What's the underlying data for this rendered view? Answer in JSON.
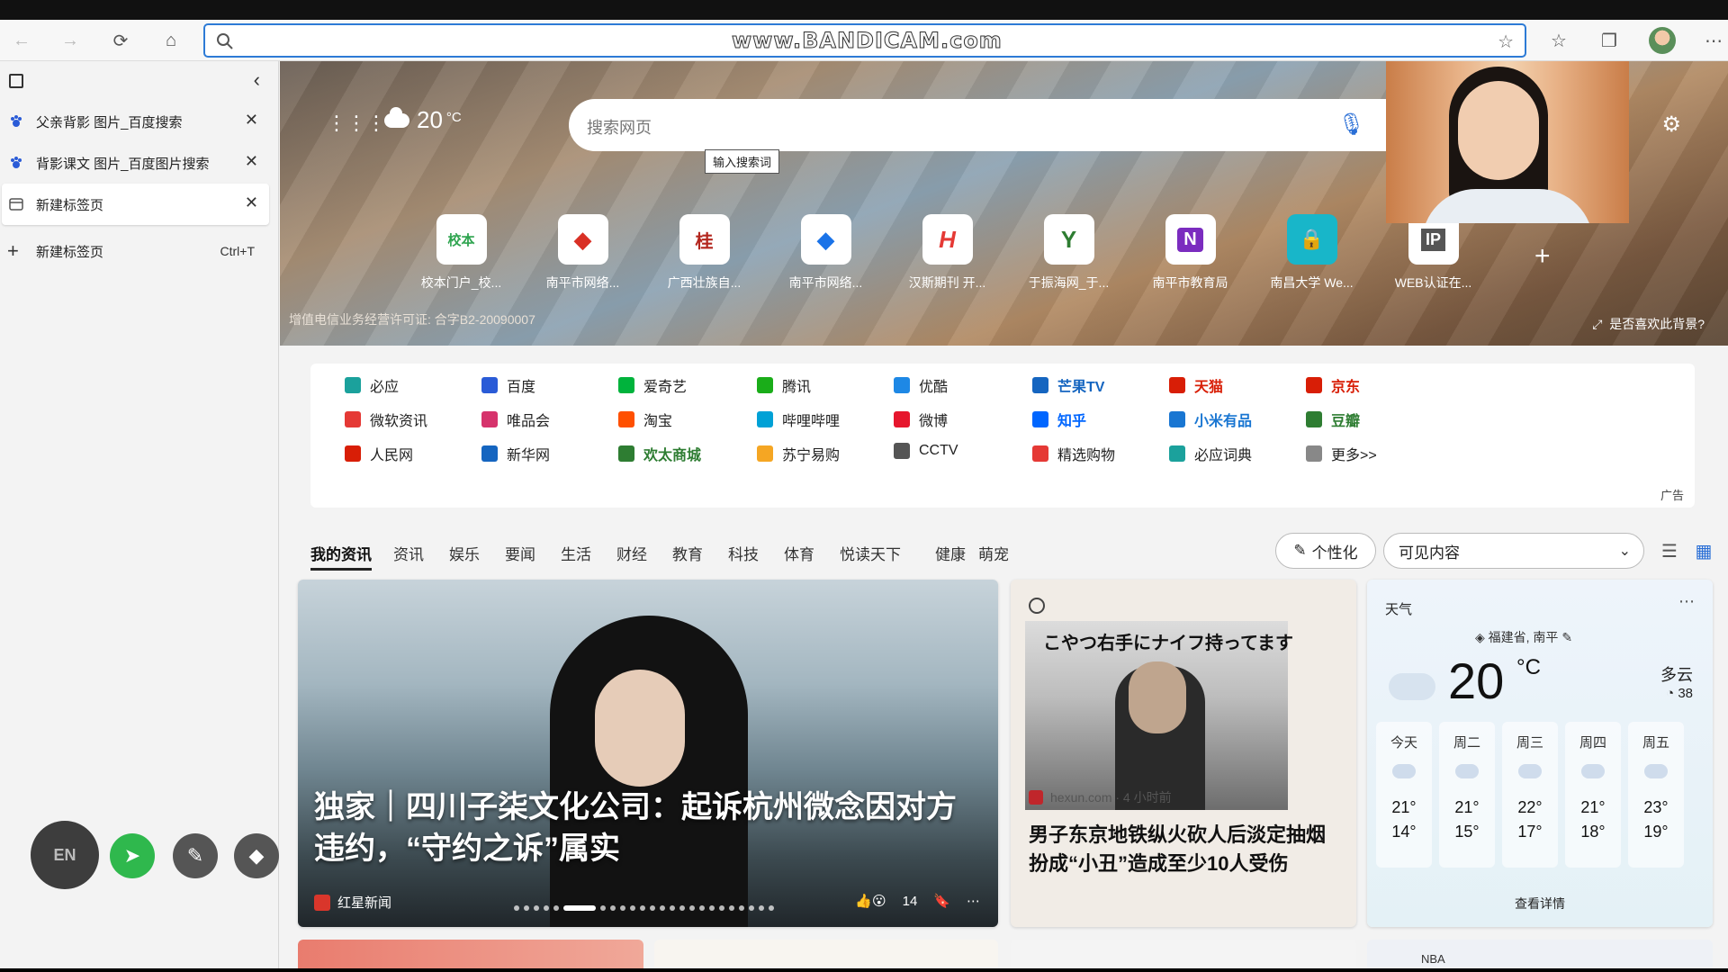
{
  "browser": {
    "watermark": "www.BANDICAM.com",
    "address_placeholder": ""
  },
  "sidebar": {
    "tabs": [
      {
        "label": "父亲背影 图片_百度搜索",
        "active": false
      },
      {
        "label": "背影课文 图片_百度图片搜索",
        "active": false
      },
      {
        "label": "新建标签页",
        "active": true
      }
    ],
    "new_tab": {
      "label": "新建标签页",
      "shortcut": "Ctrl+T"
    }
  },
  "annot_tools": {
    "lang": "EN"
  },
  "hero": {
    "temperature": "20",
    "temp_unit": "°C",
    "search_placeholder": "搜索网页",
    "tooltip": "输入搜索词",
    "quick_links": [
      {
        "label": "校本门户_校...",
        "glyph": "校本",
        "color": "#2ea44f"
      },
      {
        "label": "南平市网络...",
        "glyph": "◆",
        "color": "#d93025"
      },
      {
        "label": "广西壮族自...",
        "glyph": "桂",
        "color": "#b3261e"
      },
      {
        "label": "南平市网络...",
        "glyph": "◆",
        "color": "#1a73e8"
      },
      {
        "label": "汉斯期刊 开...",
        "glyph": "H",
        "color": "#e53935"
      },
      {
        "label": "于振海网_于...",
        "glyph": "Y",
        "color": "#2e7d32"
      },
      {
        "label": "南平市教育局",
        "glyph": "N",
        "color": "#7b2cbf"
      },
      {
        "label": "南昌大学 We...",
        "glyph": "🔒",
        "color": "#18b6c9"
      },
      {
        "label": "WEB认证在...",
        "glyph": "IP",
        "color": "#555555"
      }
    ],
    "license": "增值电信业务经营许可证: 合字B2-20090007",
    "like_background": "是否喜欢此背景?"
  },
  "links": [
    [
      {
        "label": "必应",
        "color": "#1ba19c",
        "bold": false
      },
      {
        "label": "百度",
        "color": "#2a5bd7",
        "bold": false
      },
      {
        "label": "爱奇艺",
        "color": "#00b33c",
        "bold": false
      },
      {
        "label": "腾讯",
        "color": "#1aad19",
        "bold": false
      },
      {
        "label": "优酷",
        "color": "#1e88e5",
        "bold": false
      },
      {
        "label": "芒果TV",
        "color": "#1565c0",
        "bold": true
      },
      {
        "label": "天猫",
        "color": "#d81e06",
        "bold": true
      },
      {
        "label": "京东",
        "color": "#d81e06",
        "bold": true
      }
    ],
    [
      {
        "label": "微软资讯",
        "color": "#e53935",
        "bold": false
      },
      {
        "label": "唯品会",
        "color": "#d6336c",
        "bold": false
      },
      {
        "label": "淘宝",
        "color": "#ff5000",
        "bold": false
      },
      {
        "label": "哔哩哔哩",
        "color": "#00a1d6",
        "bold": false
      },
      {
        "label": "微博",
        "color": "#e6162d",
        "bold": false
      },
      {
        "label": "知乎",
        "color": "#0066ff",
        "bold": true
      },
      {
        "label": "小米有品",
        "color": "#1976d2",
        "bold": true
      },
      {
        "label": "豆瓣",
        "color": "#2e7d32",
        "bold": true
      }
    ],
    [
      {
        "label": "人民网",
        "color": "#d81e06",
        "bold": false
      },
      {
        "label": "新华网",
        "color": "#1565c0",
        "bold": false
      },
      {
        "label": "欢太商城",
        "color": "#2e7d32",
        "bold": true
      },
      {
        "label": "苏宁易购",
        "color": "#f5a623",
        "bold": false
      },
      {
        "label": "CCTV",
        "color": "#555555",
        "bold": false
      },
      {
        "label": "精选购物",
        "color": "#e53935",
        "bold": false
      },
      {
        "label": "必应词典",
        "color": "#1ba19c",
        "bold": false
      },
      {
        "label": "更多>>",
        "color": "#888888",
        "bold": false
      }
    ]
  ],
  "ad_label": "广告",
  "news_tabs": [
    "我的资讯",
    "资讯",
    "娱乐",
    "要闻",
    "生活",
    "财经",
    "教育",
    "科技",
    "体育",
    "悦读天下",
    "健康",
    "萌宠"
  ],
  "personalize_label": "个性化",
  "visible_content_label": "可见内容",
  "main_card": {
    "headline": "独家｜四川子柒文化公司：起诉杭州微念因对方违约，“守约之诉”属实",
    "source": "红星新闻",
    "reactions": "14"
  },
  "card2": {
    "image_text": "こやつ右手にナイフ持ってます",
    "source": "hexun.com · 4 小时前",
    "title": "男子东京地铁纵火砍人后淡定抽烟 扮成“小丑”造成至少10人受伤"
  },
  "weather": {
    "title": "天气",
    "location": "福建省, 南平",
    "temp": "20",
    "unit": "°C",
    "condition": "多云",
    "aqi": "38",
    "forecast": [
      {
        "day": "今天",
        "hi": "21°",
        "lo": "14°"
      },
      {
        "day": "周二",
        "hi": "21°",
        "lo": "15°"
      },
      {
        "day": "周三",
        "hi": "22°",
        "lo": "17°"
      },
      {
        "day": "周四",
        "hi": "21°",
        "lo": "18°"
      },
      {
        "day": "周五",
        "hi": "23°",
        "lo": "19°"
      }
    ],
    "details": "查看详情"
  },
  "row2": {
    "nba": "NBA"
  }
}
